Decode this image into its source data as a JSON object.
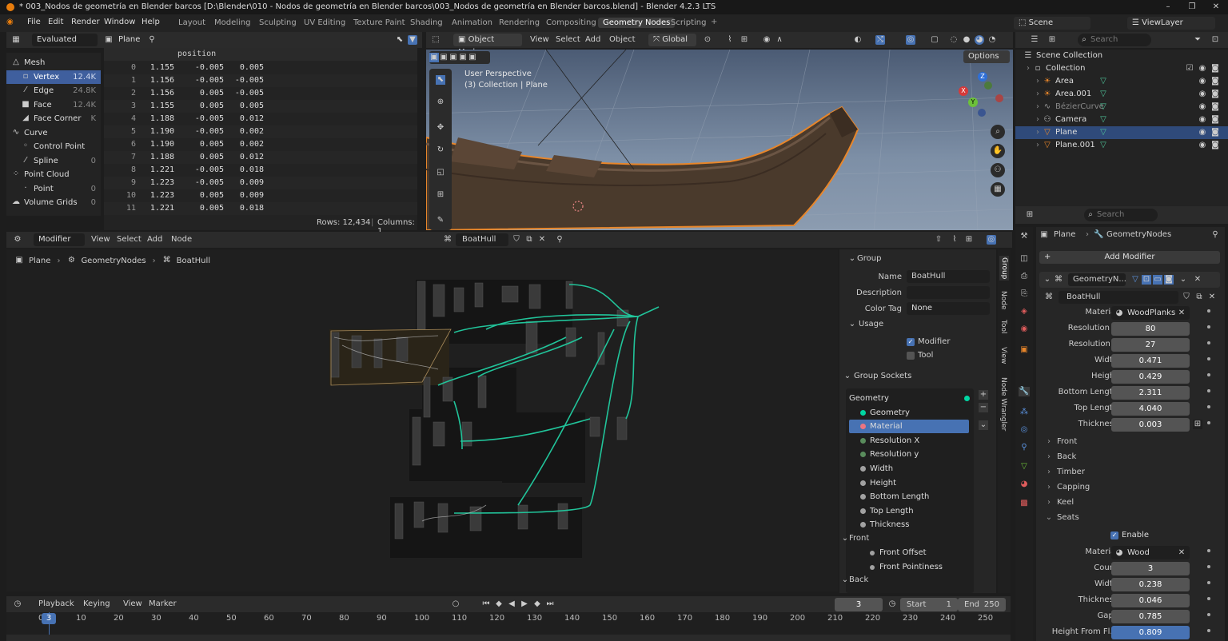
{
  "title": "* 003_Nodos de geometría en Blender barcos [D:\\Blender\\010 - Nodos de geometría en Blender barcos\\003_Nodos de geometría en Blender barcos.blend] - Blender 4.2.3 LTS",
  "menu": [
    "File",
    "Edit",
    "Render",
    "Window",
    "Help"
  ],
  "workspaces": [
    "Layout",
    "Modeling",
    "Sculpting",
    "UV Editing",
    "Texture Paint",
    "Shading",
    "Animation",
    "Rendering",
    "Compositing",
    "Geometry Nodes",
    "Scripting"
  ],
  "topright": {
    "scene": "Scene",
    "viewlayer": "ViewLayer"
  },
  "spreadsheet": {
    "mode": "Evaluated",
    "object": "Plane",
    "column": "position",
    "tree": [
      {
        "label": "Mesh",
        "count": ""
      },
      {
        "label": "Vertex",
        "count": "12.4K"
      },
      {
        "label": "Edge",
        "count": "24.8K"
      },
      {
        "label": "Face",
        "count": "12.4K"
      },
      {
        "label": "Face Corner",
        "count": "K"
      },
      {
        "label": "Curve",
        "count": ""
      },
      {
        "label": "Control Point",
        "count": ""
      },
      {
        "label": "Spline",
        "count": "0"
      },
      {
        "label": "Point Cloud",
        "count": ""
      },
      {
        "label": "Point",
        "count": "0"
      },
      {
        "label": "Volume Grids",
        "count": "0"
      }
    ],
    "rows": [
      [
        "0",
        "1.155",
        "-0.005",
        "0.005"
      ],
      [
        "1",
        "1.156",
        "-0.005",
        "-0.005"
      ],
      [
        "2",
        "1.156",
        "0.005",
        "-0.005"
      ],
      [
        "3",
        "1.155",
        "0.005",
        "0.005"
      ],
      [
        "4",
        "1.188",
        "-0.005",
        "0.012"
      ],
      [
        "5",
        "1.190",
        "-0.005",
        "0.002"
      ],
      [
        "6",
        "1.190",
        "0.005",
        "0.002"
      ],
      [
        "7",
        "1.188",
        "0.005",
        "0.012"
      ],
      [
        "8",
        "1.221",
        "-0.005",
        "0.018"
      ],
      [
        "9",
        "1.223",
        "-0.005",
        "0.009"
      ],
      [
        "10",
        "1.223",
        "0.005",
        "0.009"
      ],
      [
        "11",
        "1.221",
        "0.005",
        "0.018"
      ]
    ],
    "footer_rows": "Rows: 12,434",
    "footer_cols": "Columns: 1"
  },
  "viewport": {
    "mode": "Object Mode",
    "menu": [
      "View",
      "Select",
      "Add",
      "Object"
    ],
    "orientation": "Global",
    "options": "Options",
    "overlay_line1": "User Perspective",
    "overlay_line2": "(3) Collection | Plane",
    "gizmo_axes": [
      "Z",
      "X",
      "Y"
    ]
  },
  "outliner": {
    "search_placeholder": "Search",
    "items": [
      {
        "label": "Scene Collection",
        "depth": 0,
        "sel": false
      },
      {
        "label": "Collection",
        "depth": 1,
        "sel": false
      },
      {
        "label": "Area",
        "depth": 2,
        "sel": false
      },
      {
        "label": "Area.001",
        "depth": 2,
        "sel": false
      },
      {
        "label": "BézierCurve",
        "depth": 2,
        "sel": false
      },
      {
        "label": "Camera",
        "depth": 2,
        "sel": false
      },
      {
        "label": "Plane",
        "depth": 2,
        "sel": true
      },
      {
        "label": "Plane.001",
        "depth": 2,
        "sel": false
      }
    ]
  },
  "node_editor": {
    "editor": "Modifier",
    "menu": [
      "View",
      "Select",
      "Add",
      "Node"
    ],
    "tree_name": "BoatHull",
    "breadcrumb": [
      "Plane",
      "GeometryNodes",
      "BoatHull"
    ]
  },
  "node_sidebar": {
    "tabs": [
      "Group",
      "Node",
      "Tool",
      "View",
      "Node Wrangler"
    ],
    "group_header": "Group",
    "name_label": "Name",
    "name_value": "BoatHull",
    "desc_label": "Description",
    "color_label": "Color Tag",
    "color_value": "None",
    "usage_header": "Usage",
    "modifier": "Modifier",
    "tool": "Tool",
    "sockets_header": "Group Sockets",
    "sockets": [
      {
        "label": "Geometry",
        "color": "#00d6a3",
        "out": true
      },
      {
        "label": "Geometry",
        "color": "#00d6a3",
        "out": false
      },
      {
        "label": "Material",
        "color": "#eb7582",
        "out": false
      },
      {
        "label": "Resolution X",
        "color": "#598c5c",
        "out": false
      },
      {
        "label": "Resolution y",
        "color": "#598c5c",
        "out": false
      },
      {
        "label": "Width",
        "color": "#a1a1a1",
        "out": false
      },
      {
        "label": "Height",
        "color": "#a1a1a1",
        "out": false
      },
      {
        "label": "Bottom Length",
        "color": "#a1a1a1",
        "out": false
      },
      {
        "label": "Top Length",
        "color": "#a1a1a1",
        "out": false
      },
      {
        "label": "Thickness",
        "color": "#a1a1a1",
        "out": false
      }
    ],
    "front": "Front",
    "front_items": [
      "Front Offset",
      "Front Pointiness"
    ],
    "back": "Back"
  },
  "properties": {
    "breadcrumb_obj": "Plane",
    "breadcrumb_mod": "GeometryNodes",
    "search_placeholder": "Search",
    "add_modifier": "Add Modifier",
    "modifier_name": "GeometryN...",
    "tree": "BoatHull",
    "fields": [
      {
        "label": "Material",
        "value": "WoodPlanks",
        "kind": "mat"
      },
      {
        "label": "Resolution X",
        "value": "80"
      },
      {
        "label": "Resolution y",
        "value": "27"
      },
      {
        "label": "Width",
        "value": "0.471"
      },
      {
        "label": "Height",
        "value": "0.429"
      },
      {
        "label": "Bottom Length",
        "value": "2.311"
      },
      {
        "label": "Top Length",
        "value": "4.040"
      },
      {
        "label": "Thickness",
        "value": "0.003"
      }
    ],
    "sections": [
      "Front",
      "Back",
      "Timber",
      "Capping",
      "Keel",
      "Seats"
    ],
    "seats_enable": "Enable",
    "seats_fields": [
      {
        "label": "Material",
        "value": "Wood",
        "kind": "mat"
      },
      {
        "label": "Count",
        "value": "3"
      },
      {
        "label": "Width",
        "value": "0.238"
      },
      {
        "label": "Thickness",
        "value": "0.046"
      },
      {
        "label": "Gaps",
        "value": "0.785"
      },
      {
        "label": "Height From Fl...",
        "value": "0.809",
        "blue": true
      }
    ]
  },
  "timeline": {
    "menu": [
      "Playback",
      "Keying",
      "View",
      "Marker"
    ],
    "current": "3",
    "start_label": "Start",
    "start": "1",
    "end_label": "End",
    "end": "250",
    "ticks": [
      "0",
      "10",
      "20",
      "30",
      "40",
      "50",
      "60",
      "70",
      "80",
      "90",
      "100",
      "110",
      "120",
      "130",
      "140",
      "150",
      "160",
      "170",
      "180",
      "190",
      "200",
      "210",
      "220",
      "230",
      "240",
      "250"
    ]
  }
}
